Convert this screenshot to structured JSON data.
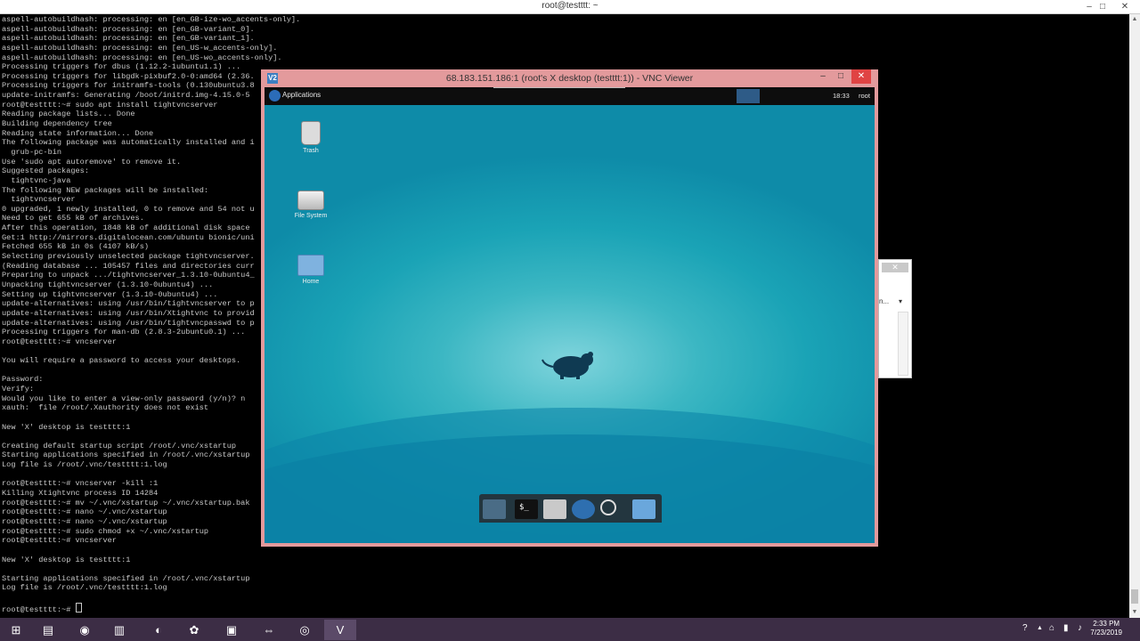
{
  "outer_window": {
    "title": "root@testttt: ~",
    "minimize": "–",
    "maximize": "□",
    "close": "✕"
  },
  "terminal": {
    "lines": [
      "aspell-autobuildhash: processing: en [en_GB-ize-wo_accents-only].",
      "aspell-autobuildhash: processing: en [en_GB-variant_0].",
      "aspell-autobuildhash: processing: en [en_GB-variant_1].",
      "aspell-autobuildhash: processing: en [en_US-w_accents-only].",
      "aspell-autobuildhash: processing: en [en_US-wo_accents-only].",
      "Processing triggers for dbus (1.12.2-1ubuntu1.1) ...",
      "Processing triggers for libgdk-pixbuf2.0-0:amd64 (2.36.",
      "Processing triggers for initramfs-tools (0.130ubuntu3.8",
      "update-initramfs: Generating /boot/initrd.img-4.15.0-5",
      "root@testttt:~# sudo apt install tightvncserver",
      "Reading package lists... Done",
      "Building dependency tree",
      "Reading state information... Done",
      "The following package was automatically installed and i",
      "  grub-pc-bin",
      "Use 'sudo apt autoremove' to remove it.",
      "Suggested packages:",
      "  tightvnc-java",
      "The following NEW packages will be installed:",
      "  tightvncserver",
      "0 upgraded, 1 newly installed, 0 to remove and 54 not u",
      "Need to get 655 kB of archives.",
      "After this operation, 1848 kB of additional disk space",
      "Get:1 http://mirrors.digitalocean.com/ubuntu bionic/uni",
      "Fetched 655 kB in 0s (4107 kB/s)",
      "Selecting previously unselected package tightvncserver.",
      "(Reading database ... 105457 files and directories curr",
      "Preparing to unpack .../tightvncserver_1.3.10-0ubuntu4_",
      "Unpacking tightvncserver (1.3.10-0ubuntu4) ...",
      "Setting up tightvncserver (1.3.10-0ubuntu4) ...",
      "update-alternatives: using /usr/bin/tightvncserver to p",
      "update-alternatives: using /usr/bin/Xtightvnc to provid",
      "update-alternatives: using /usr/bin/tightvncpasswd to p",
      "Processing triggers for man-db (2.8.3-2ubuntu0.1) ...",
      "root@testttt:~# vncserver",
      "",
      "You will require a password to access your desktops.",
      "",
      "Password:",
      "Verify:",
      "Would you like to enter a view-only password (y/n)? n",
      "xauth:  file /root/.Xauthority does not exist",
      "",
      "New 'X' desktop is testttt:1",
      "",
      "Creating default startup script /root/.vnc/xstartup",
      "Starting applications specified in /root/.vnc/xstartup",
      "Log file is /root/.vnc/testttt:1.log",
      "",
      "root@testttt:~# vncserver -kill :1",
      "Killing Xtightvnc process ID 14284",
      "root@testttt:~# mv ~/.vnc/xstartup ~/.vnc/xstartup.bak",
      "root@testttt:~# nano ~/.vnc/xstartup",
      "root@testttt:~# nano ~/.vnc/xstartup",
      "root@testttt:~# sudo chmod +x ~/.vnc/xstartup",
      "root@testttt:~# vncserver",
      "",
      "New 'X' desktop is testttt:1",
      "",
      "Starting applications specified in /root/.vnc/xstartup",
      "Log file is /root/.vnc/testttt:1.log",
      "",
      "root@testttt:~# "
    ]
  },
  "background_dialog": {
    "close": "✕",
    "select_text": "n..."
  },
  "vnc_window": {
    "title": "68.183.151.186:1 (root's X desktop (testttt:1)) - VNC Viewer",
    "icon_text": "V2",
    "minimize": "–",
    "maximize": "□",
    "close": "✕"
  },
  "xfce": {
    "applications": "Applications",
    "clock": "18:33",
    "user": "root",
    "icons": [
      {
        "label": "Trash"
      },
      {
        "label": "File System"
      },
      {
        "label": "Home"
      }
    ],
    "dock_terminal_glyph": "$_"
  },
  "taskbar": {
    "time": "2:33 PM",
    "date": "7/23/2019",
    "help_icon": "?",
    "up_icon": "▲"
  }
}
